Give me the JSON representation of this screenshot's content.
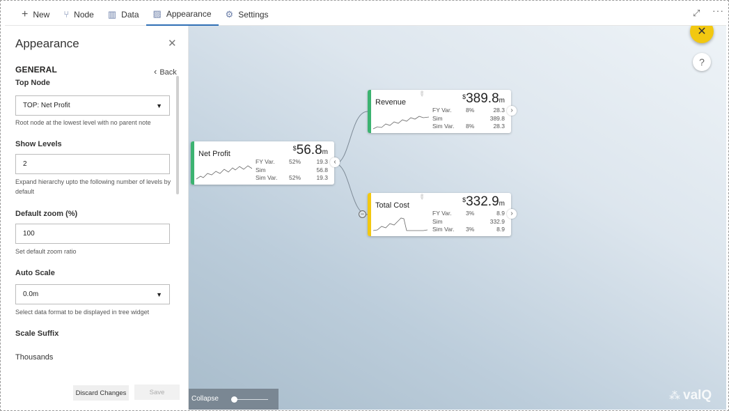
{
  "topbar": {
    "items": [
      {
        "icon": "plus-icon",
        "label": "New"
      },
      {
        "icon": "node-icon",
        "label": "Node"
      },
      {
        "icon": "data-icon",
        "label": "Data"
      },
      {
        "icon": "appearance-icon",
        "label": "Appearance"
      },
      {
        "icon": "gear-icon",
        "label": "Settings"
      }
    ],
    "active": "Appearance"
  },
  "panel": {
    "title": "Appearance",
    "section": "GENERAL",
    "back_label": "Back",
    "top_node": {
      "label": "Top Node",
      "value": "TOP: Net Profit",
      "hint": "Root node at the lowest level with no parent note"
    },
    "show_levels": {
      "label": "Show Levels",
      "value": "2",
      "hint": "Expand hierarchy upto the following number of levels by default"
    },
    "default_zoom": {
      "label": "Default zoom (%)",
      "value": "100",
      "hint": "Set default zoom ratio"
    },
    "auto_scale": {
      "label": "Auto Scale",
      "value": "0.0m",
      "hint": "Select data format to be displayed in tree widget"
    },
    "scale_suffix": {
      "label": "Scale Suffix",
      "value": "Thousands"
    },
    "discard_label": "Discard Changes",
    "save_label": "Save"
  },
  "canvas": {
    "collapse_label": "Collapse",
    "brand": "valQ",
    "colors": {
      "green": "#3cb371",
      "yellow": "#f2c811",
      "close_btn": "#f2c811"
    },
    "nodes": [
      {
        "key": "net_profit",
        "name": "Net Profit",
        "currency": "$",
        "value": "56.8",
        "unit": "m",
        "color": "#3cb371",
        "rows": [
          [
            "FY Var.",
            "52%",
            "19.3"
          ],
          [
            "Sim",
            "",
            "56.8"
          ],
          [
            "Sim Var.",
            "52%",
            "19.3"
          ]
        ]
      },
      {
        "key": "revenue",
        "name": "Revenue",
        "currency": "$",
        "value": "389.8",
        "unit": "m",
        "color": "#3cb371",
        "rows": [
          [
            "FY Var.",
            "8%",
            "28.3"
          ],
          [
            "Sim",
            "",
            "389.8"
          ],
          [
            "Sim Var.",
            "8%",
            "28.3"
          ]
        ]
      },
      {
        "key": "total_cost",
        "name": "Total Cost",
        "currency": "$",
        "value": "332.9",
        "unit": "m",
        "color": "#f2c811",
        "rows": [
          [
            "FY Var.",
            "3%",
            "8.9"
          ],
          [
            "Sim",
            "",
            "332.9"
          ],
          [
            "Sim Var.",
            "3%",
            "8.9"
          ]
        ]
      }
    ]
  }
}
